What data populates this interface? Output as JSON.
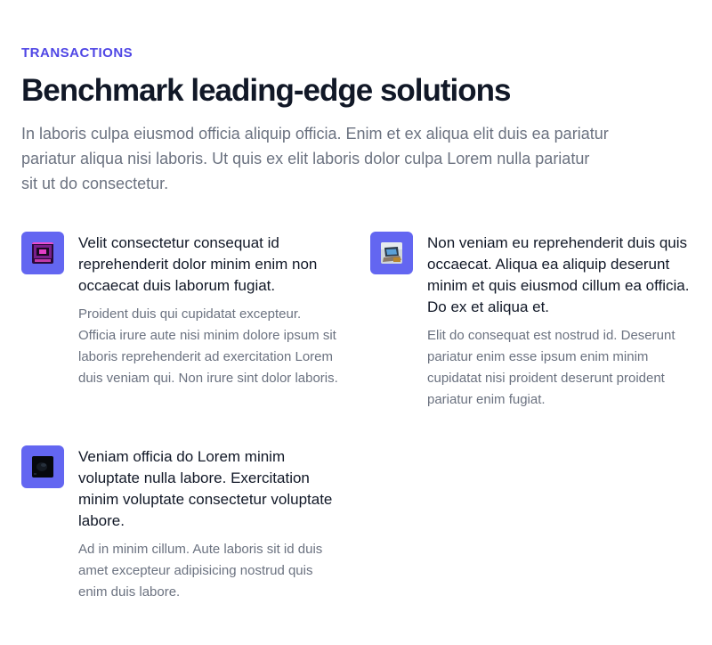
{
  "section": {
    "eyebrow": "TRANSACTIONS",
    "headline": "Benchmark leading-edge solutions",
    "lede": "In laboris culpa eiusmod officia aliquip officia. Enim et ex aliqua elit duis ea pariatur pariatur aliqua nisi laboris. Ut quis ex elit laboris dolor culpa Lorem nulla pariatur sit ut do consectetur."
  },
  "features": [
    {
      "icon": "photo-thumbnail-icon",
      "title": "Velit consectetur consequat id reprehenderit dolor minim enim non occaecat duis laborum fugiat.",
      "description": "Proident duis qui cupidatat excepteur. Officia irure aute nisi minim dolore ipsum sit laboris reprehenderit ad exercitation Lorem duis veniam qui. Non irure sint dolor laboris."
    },
    {
      "icon": "laptop-thumbnail-icon",
      "title": "Non veniam eu reprehenderit duis quis occaecat. Aliqua ea aliquip deserunt minim et quis eiusmod cillum ea officia. Do ex et aliqua et.",
      "description": "Elit do consequat est nostrud id. Deserunt pariatur enim esse ipsum enim minim cupidatat nisi proident deserunt proident pariatur enim fugiat."
    },
    {
      "icon": "dark-thumbnail-icon",
      "title": "Veniam officia do Lorem minim voluptate nulla labore. Exercitation minim voluptate consectetur voluptate labore.",
      "description": "Ad in minim cillum. Aute laboris sit id duis amet excepteur adipisicing nostrud quis enim duis labore."
    }
  ],
  "colors": {
    "accent": "#4f46e5",
    "icon_bg": "#6366f1",
    "heading": "#111827",
    "body": "#6b7280"
  }
}
